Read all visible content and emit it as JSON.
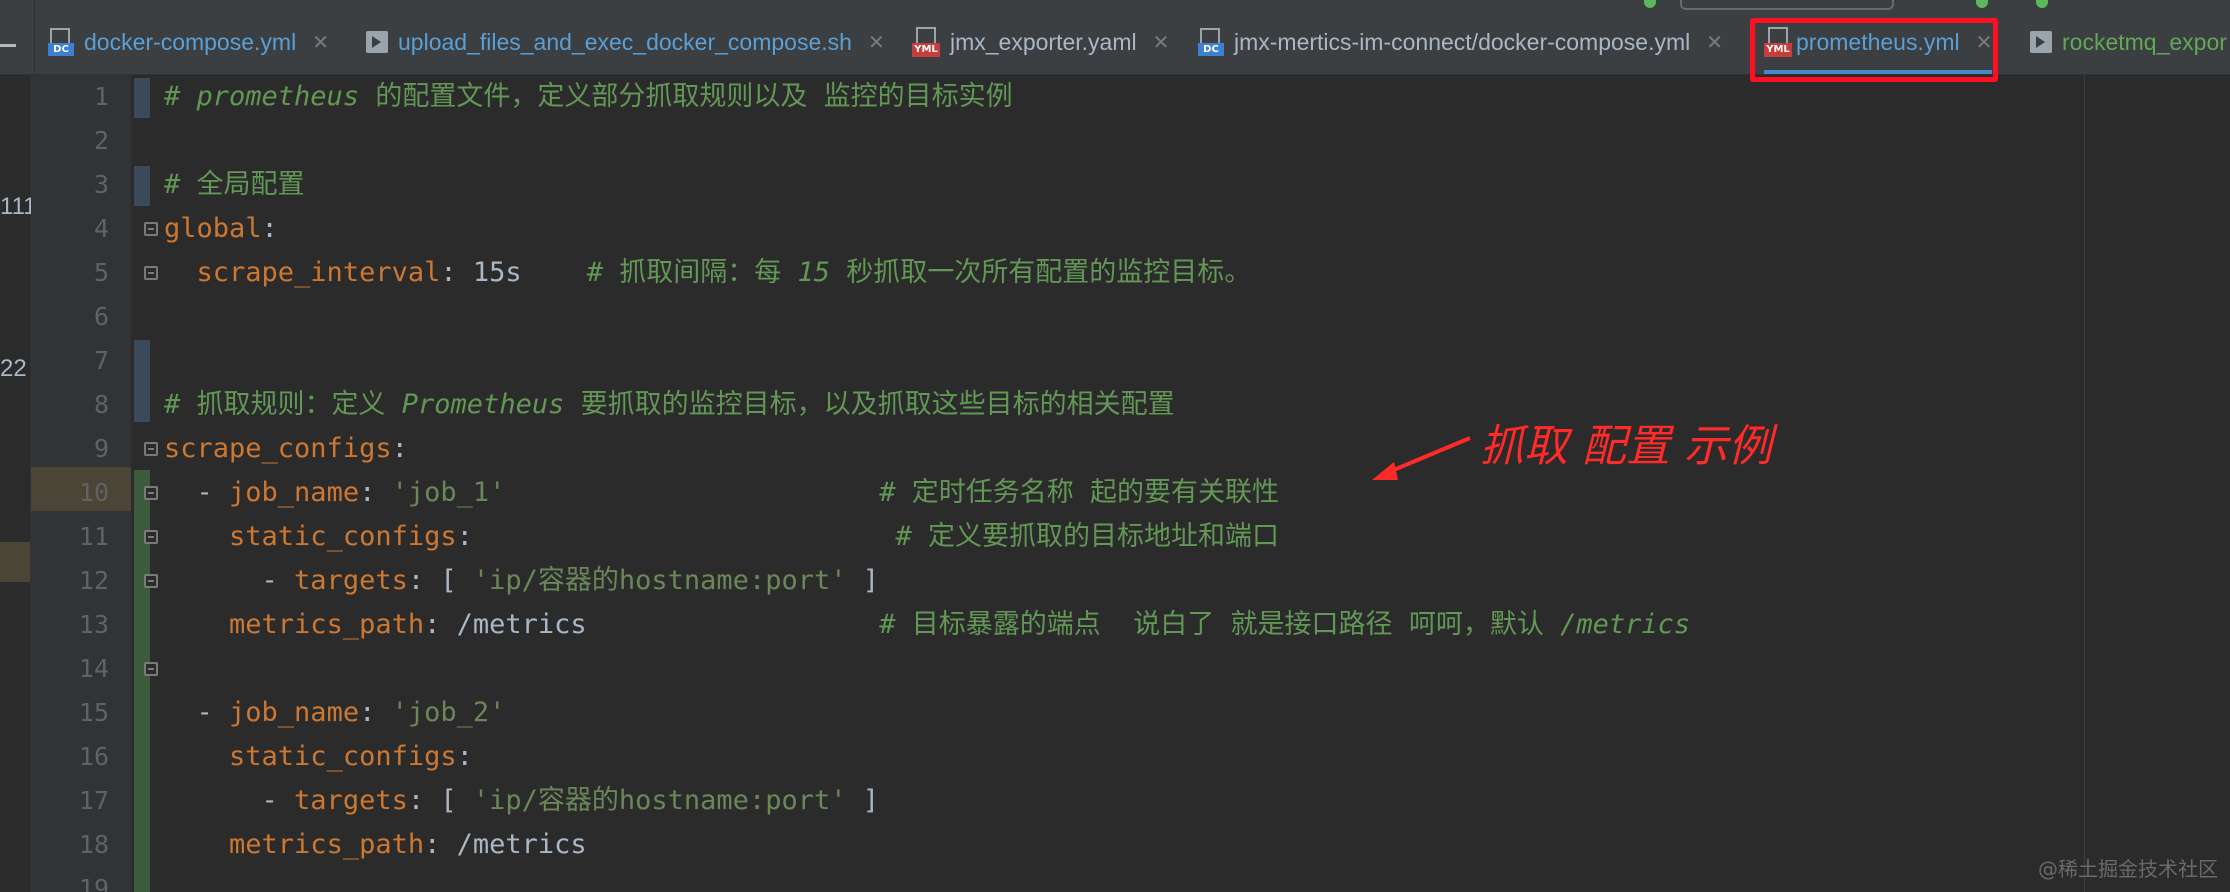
{
  "tabs": [
    {
      "label": "docker-compose.yml",
      "icon": "docker-compose-file-icon",
      "color": "blue"
    },
    {
      "label": "upload_files_and_exec_docker_compose.sh",
      "icon": "shell-script-icon",
      "color": "blue"
    },
    {
      "label": "jmx_exporter.yaml",
      "icon": "yaml-file-icon",
      "color": "default"
    },
    {
      "label": "jmx-mertics-im-connect/docker-compose.yml",
      "icon": "docker-compose-file-icon",
      "color": "default"
    },
    {
      "label": "prometheus.yml",
      "icon": "yaml-file-icon",
      "color": "blue",
      "active": true
    },
    {
      "label": "rocketmq_expor",
      "icon": "shell-script-icon",
      "color": "green"
    }
  ],
  "tab_icon_text": {
    "dc": "DC",
    "yml": "YML"
  },
  "close_glyph": "✕",
  "left_strip": {
    "numbers": [
      "111",
      "22"
    ]
  },
  "line_numbers": [
    "1",
    "2",
    "3",
    "4",
    "5",
    "6",
    "7",
    "8",
    "9",
    "10",
    "11",
    "12",
    "13",
    "14",
    "15",
    "16",
    "17",
    "18",
    "19"
  ],
  "code": {
    "l1": {
      "hash": "# ",
      "word": "prometheus",
      "rest": " 的配置文件，定义部分抓取规则以及 监控的目标实例"
    },
    "l3": "# 全局配置",
    "l4": {
      "key": "global",
      "colon": ":"
    },
    "l5": {
      "indent": "  ",
      "key": "scrape_interval",
      "colon": ": ",
      "value": "15s",
      "gap": "    ",
      "c1": "# 抓取间隔：每 ",
      "cnum": "15",
      "c2": " 秒抓取一次所有配置的监控目标。"
    },
    "l8": {
      "c1": "# 抓取规则：定义 ",
      "word": "Prometheus",
      "c2": " 要抓取的监控目标，以及抓取这些目标的相关配置"
    },
    "l9": {
      "key": "scrape_configs",
      "colon": ":"
    },
    "l10": {
      "pre": "  - ",
      "key": "job_name",
      "colon": ": ",
      "value": "'job_1'",
      "gap": "                       ",
      "comment": "# 定时任务名称 起的要有关联性"
    },
    "l11": {
      "pre": "    ",
      "key": "static_configs",
      "colon": ":",
      "gap": "                          ",
      "comment": "# 定义要抓取的目标地址和端口"
    },
    "l12": {
      "pre": "      - ",
      "key": "targets",
      "colon": ": [ ",
      "value": "'ip/容器的hostname:port'",
      "end": " ]"
    },
    "l13": {
      "pre": "    ",
      "key": "metrics_path",
      "colon": ": ",
      "value": "/metrics",
      "gap": "                  ",
      "c1": "# 目标暴露的端点  说白了 就是接口路径 呵呵，默认 ",
      "word": "/metrics"
    },
    "l15": {
      "pre": "  - ",
      "key": "job_name",
      "colon": ": ",
      "value": "'job_2'"
    },
    "l16": {
      "pre": "    ",
      "key": "static_configs",
      "colon": ":"
    },
    "l17": {
      "pre": "      - ",
      "key": "targets",
      "colon": ": [ ",
      "value": "'ip/容器的hostname:port'",
      "end": " ]"
    },
    "l18": {
      "pre": "    ",
      "key": "metrics_path",
      "colon": ": ",
      "value": "/metrics"
    }
  },
  "annotation": {
    "text": "抓取 配置 示例",
    "color": "#ff2a2a"
  },
  "watermark": "@稀土掘金技术社区",
  "colors": {
    "background": "#2b2b2b",
    "gutter": "#313335",
    "keyword": "#cc7832",
    "string": "#6a8759",
    "comment": "#629755",
    "highlight_box": "#ff0f1f"
  }
}
